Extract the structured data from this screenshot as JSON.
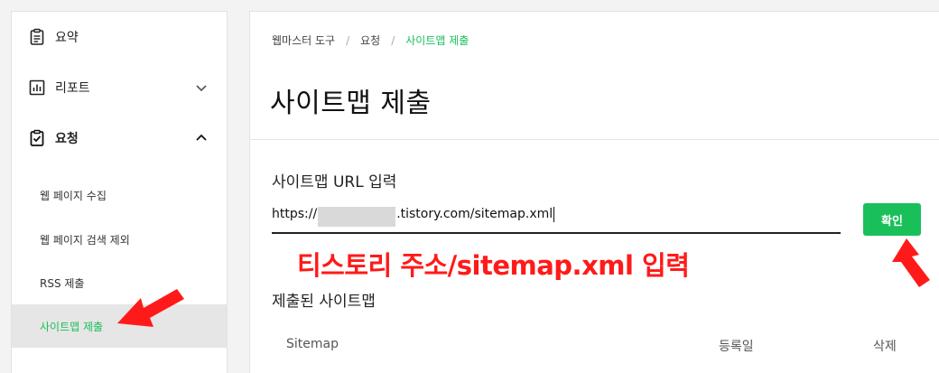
{
  "sidebar": {
    "items": [
      {
        "label": "요약",
        "icon": "clipboard-icon"
      },
      {
        "label": "리포트",
        "icon": "bar-chart-icon",
        "chevron": "chevron-down-icon"
      },
      {
        "label": "요청",
        "icon": "clipboard-check-icon",
        "chevron": "chevron-up-icon"
      }
    ],
    "subitems": [
      {
        "label": "웹 페이지 수집"
      },
      {
        "label": "웹 페이지 검색 제외"
      },
      {
        "label": "RSS 제출"
      },
      {
        "label": "사이트맵 제출",
        "active": true
      }
    ]
  },
  "breadcrumb": {
    "items": [
      "웹마스터 도구",
      "요청",
      "사이트맵 제출"
    ],
    "separator": "/"
  },
  "page": {
    "title": "사이트맵 제출",
    "url_section_label": "사이트맵 URL 입력",
    "url_value_prefix": "https://",
    "url_value_suffix": ".tistory.com/sitemap.xml",
    "confirm_label": "확인",
    "submitted_label": "제출된 사이트맵"
  },
  "annotation": {
    "text": "티스토리 주소/sitemap.xml 입력",
    "color": "#ff1a1a"
  },
  "table": {
    "columns": [
      "Sitemap",
      "등록일",
      "삭제"
    ]
  },
  "colors": {
    "accent": "#19c05a",
    "annotation_red": "#ff1a1a"
  }
}
